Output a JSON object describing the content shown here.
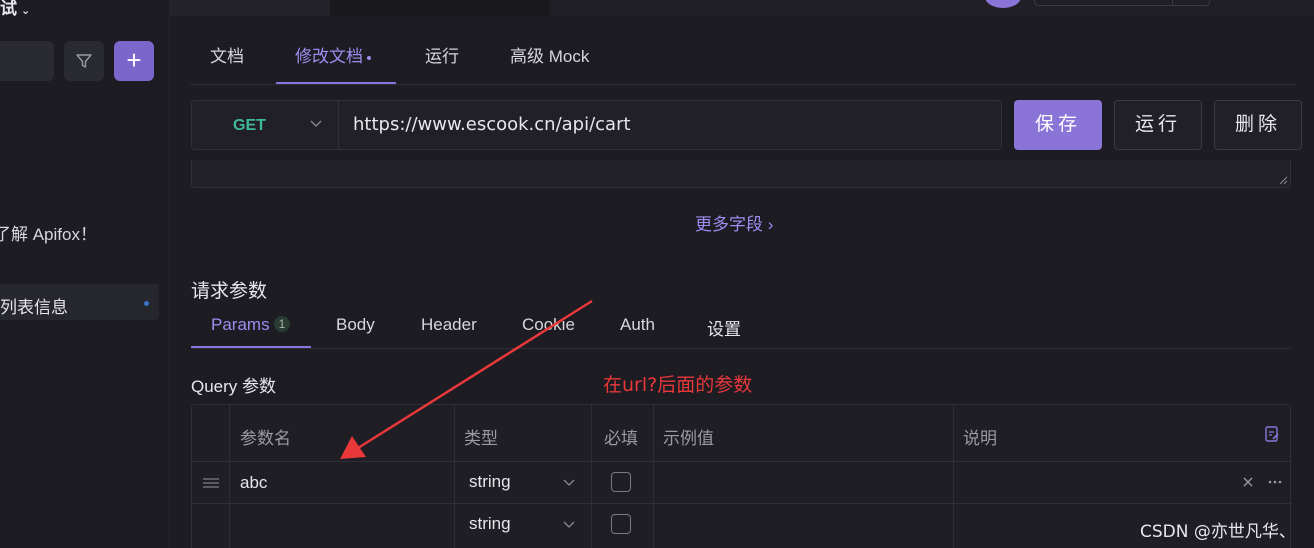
{
  "sidebar": {
    "title": "试",
    "item_apifox": "了解 Apifox！",
    "item_active": "列表信息"
  },
  "doc_tabs": [
    "文档",
    "修改文档",
    "运行",
    "高级 Mock"
  ],
  "request": {
    "method": "GET",
    "url": "https://www.escook.cn/api/cart"
  },
  "buttons": {
    "save": "保存",
    "run": "运行",
    "delete": "删除"
  },
  "more_fields": "更多字段 ›",
  "request_params_title": "请求参数",
  "param_tabs": {
    "params": "Params",
    "params_count": "1",
    "body": "Body",
    "header": "Header",
    "cookie": "Cookie",
    "auth": "Auth",
    "settings": "设置"
  },
  "query_title": "Query 参数",
  "annotation": "在url?后面的参数",
  "table": {
    "headers": [
      "参数名",
      "类型",
      "必填",
      "示例值",
      "说明"
    ],
    "rows": [
      {
        "name": "abc",
        "type": "string"
      },
      {
        "name": "",
        "type": "string"
      }
    ]
  },
  "watermark": "CSDN @亦世凡华、",
  "colors": {
    "accent": "#8a74d8",
    "method_get": "#3eb99a",
    "annotation": "#e8383a"
  }
}
